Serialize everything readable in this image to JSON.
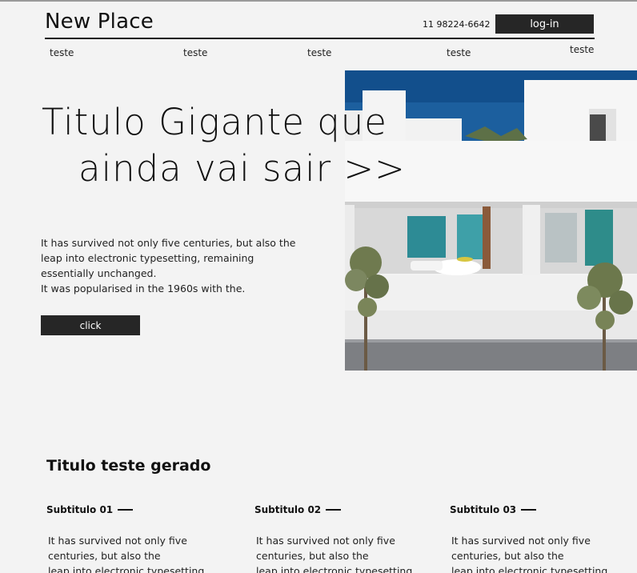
{
  "header": {
    "logo": "New Place",
    "phone": "11 98224-6642",
    "login_label": "log-in"
  },
  "nav": {
    "items": [
      "teste",
      "teste",
      "teste",
      "teste",
      "teste"
    ]
  },
  "hero": {
    "title_line1": "Titulo Gigante que",
    "title_line2": "ainda vai sair >>",
    "text_lines": [
      "It has survived not only five centuries, but also the",
      " leap into electronic typesetting, remaining",
      "essentially unchanged.",
      "It was popularised in the 1960s with the."
    ],
    "button_label": "click",
    "image_icon": "modern-white-house-photo"
  },
  "section": {
    "title": "Titulo teste gerado",
    "features": [
      {
        "subtitle": "Subtitulo 01",
        "lines": [
          "It has survived not only five",
          "centuries, but also the",
          " leap into electronic typesetting,"
        ]
      },
      {
        "subtitle": "Subtitulo 02",
        "lines": [
          "It has survived not only five",
          "centuries, but also the",
          " leap into electronic typesetting,"
        ]
      },
      {
        "subtitle": "Subtitulo 03",
        "lines": [
          "It has survived not only five",
          "centuries, but also the",
          " leap into electronic typesetting,"
        ]
      }
    ]
  },
  "colors": {
    "background": "#f3f3f3",
    "button": "#262626",
    "sky": "#1c5f9e"
  }
}
